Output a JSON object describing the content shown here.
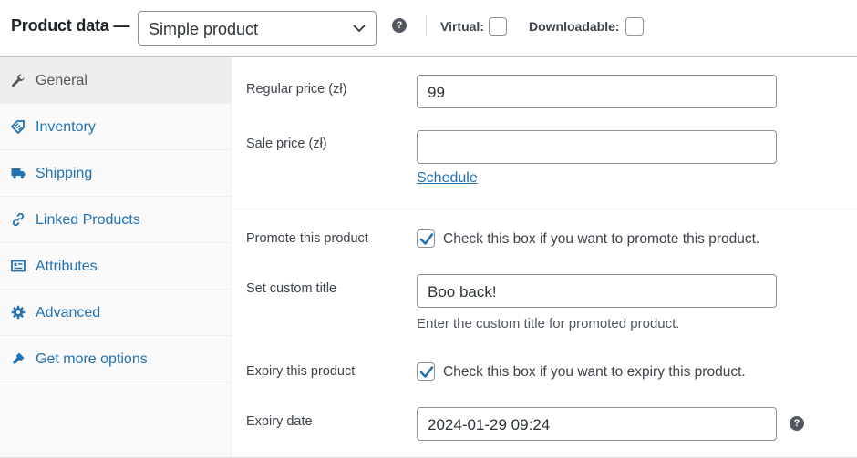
{
  "header": {
    "title": "Product data —",
    "product_type": "Simple product",
    "help_icon": "question-circle-icon",
    "virtual_label": "Virtual:",
    "virtual_checked": false,
    "downloadable_label": "Downloadable:",
    "downloadable_checked": false
  },
  "sidebar": {
    "items": [
      {
        "label": "General",
        "icon": "wrench-icon",
        "active": true
      },
      {
        "label": "Inventory",
        "icon": "tag-icon",
        "active": false
      },
      {
        "label": "Shipping",
        "icon": "truck-icon",
        "active": false
      },
      {
        "label": "Linked Products",
        "icon": "link-icon",
        "active": false
      },
      {
        "label": "Attributes",
        "icon": "list-card-icon",
        "active": false
      },
      {
        "label": "Advanced",
        "icon": "gear-icon",
        "active": false
      },
      {
        "label": "Get more options",
        "icon": "plugin-icon",
        "active": false
      }
    ]
  },
  "general": {
    "regular_price_label": "Regular price (zł)",
    "regular_price_value": "99",
    "sale_price_label": "Sale price (zł)",
    "sale_price_value": "",
    "schedule_link": "Schedule",
    "promote_label": "Promote this product",
    "promote_checked": true,
    "promote_text": "Check this box if you want to promote this product.",
    "custom_title_label": "Set custom title",
    "custom_title_value": "Boo back!",
    "custom_title_desc": "Enter the custom title for promoted product.",
    "expiry_label": "Expiry this product",
    "expiry_checked": true,
    "expiry_text": "Check this box if you want to expiry this product.",
    "expiry_date_label": "Expiry date",
    "expiry_date_value": "2024-01-29 09:24"
  },
  "colors": {
    "accent": "#2271b1",
    "text": "#3c434a",
    "border": "#8c8f94"
  }
}
